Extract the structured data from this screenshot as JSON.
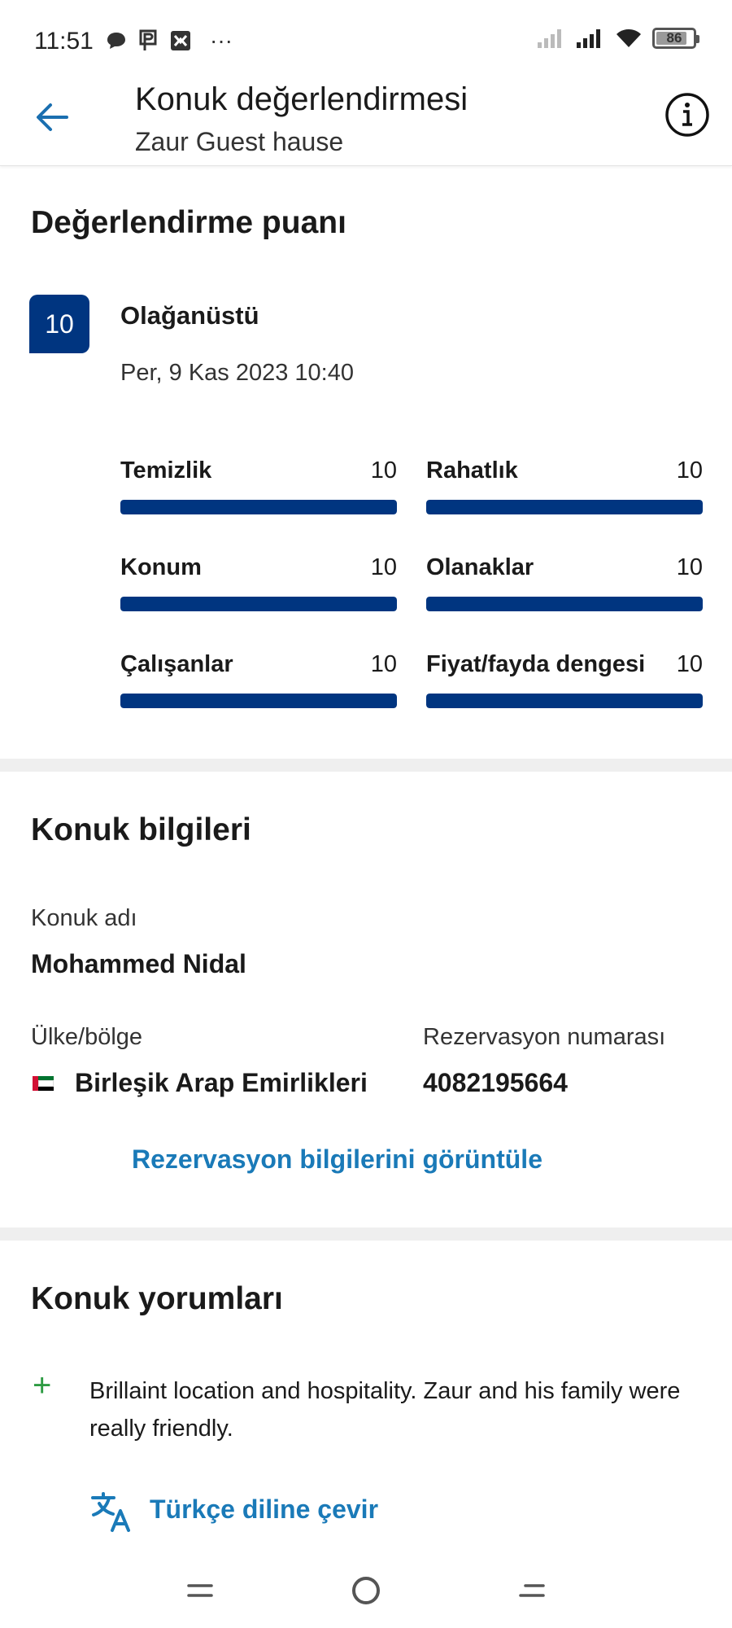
{
  "status_bar": {
    "time": "11:51",
    "more": "···",
    "battery": "86",
    "battery_level": 0.86
  },
  "header": {
    "title": "Konuk değerlendirmesi",
    "subtitle": "Zaur Guest hause"
  },
  "score_section": {
    "title": "Değerlendirme puanı",
    "score": "10",
    "label": "Olağanüstü",
    "date": "Per, 9 Kas 2023 10:40",
    "max_value": 10,
    "categories": [
      {
        "label": "Temizlik",
        "value": "10",
        "fill": 1.0
      },
      {
        "label": "Rahatlık",
        "value": "10",
        "fill": 1.0
      },
      {
        "label": "Konum",
        "value": "10",
        "fill": 1.0
      },
      {
        "label": "Olanaklar",
        "value": "10",
        "fill": 1.0
      },
      {
        "label": "Çalışanlar",
        "value": "10",
        "fill": 1.0
      },
      {
        "label": "Fiyat/fayda dengesi",
        "value": "10",
        "fill": 1.0
      }
    ]
  },
  "guest_info": {
    "title": "Konuk bilgileri",
    "name_label": "Konuk adı",
    "name": "Mohammed Nidal",
    "country_label": "Ülke/bölge",
    "country": "Birleşik Arap Emirlikleri",
    "reservation_label": "Rezervasyon numarası",
    "reservation_number": "4082195664",
    "view_link": "Rezervasyon bilgilerini görüntüle"
  },
  "comments": {
    "title": "Konuk yorumları",
    "positive_text": "Brillaint location and hospitality. Zaur and his family were really friendly.",
    "translate_link": "Türkçe diline çevir"
  },
  "colors": {
    "brand_blue": "#003580",
    "link_blue": "#1a7ab8",
    "positive_green": "#2e9b43",
    "divider": "#efefef"
  },
  "icons": {
    "back": "arrow-left-icon",
    "info": "info-circle-icon",
    "positive": "plus-icon",
    "translate": "translate-icon",
    "flag": "uae-flag-icon"
  }
}
